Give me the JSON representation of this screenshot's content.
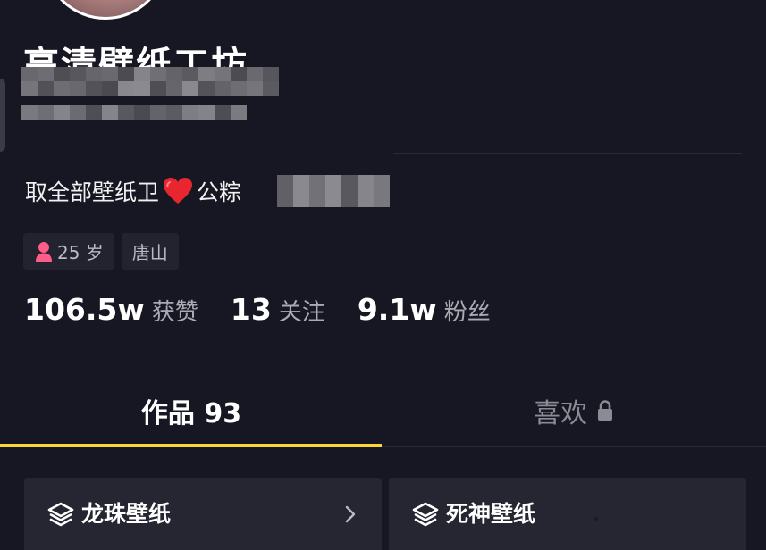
{
  "profile": {
    "name": "高清壁纸工坊",
    "bio_prefix": "取全部壁纸卫",
    "bio_suffix": "公粽",
    "tags": {
      "age": "25 岁",
      "location": "唐山"
    }
  },
  "stats": [
    {
      "value": "106.5w",
      "label": "获赞"
    },
    {
      "value": "13",
      "label": "关注"
    },
    {
      "value": "9.1w",
      "label": "粉丝"
    }
  ],
  "tabs": {
    "works": "作品 93",
    "likes": "喜欢"
  },
  "collections": [
    {
      "label": "龙珠壁纸"
    },
    {
      "label": "死神壁纸"
    }
  ],
  "colors": {
    "background": "#161722",
    "accent": "#fbd73a",
    "chip_bg": "#22232f",
    "card_bg": "#252632",
    "female_icon": "#ff5c8a",
    "heart": "#e8262f"
  },
  "icons": [
    "female-icon",
    "heart-icon",
    "lock-icon",
    "layers-icon",
    "chevron-right-icon"
  ]
}
